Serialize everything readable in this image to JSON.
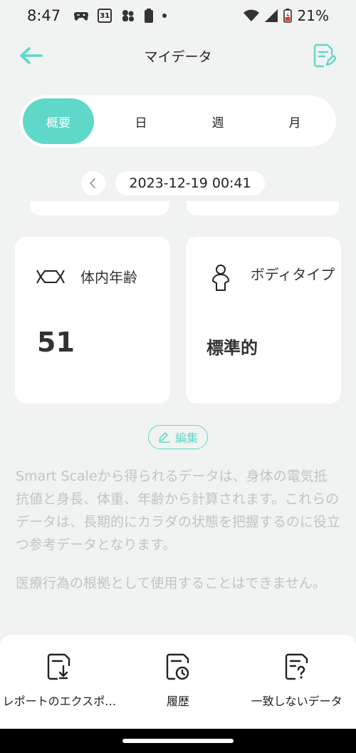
{
  "status_bar": {
    "time": "8:47",
    "calendar_day": "31",
    "battery_percent": "21%"
  },
  "app_bar": {
    "title": "マイデータ"
  },
  "tabs": [
    {
      "label": "概要",
      "active": true
    },
    {
      "label": "日",
      "active": false
    },
    {
      "label": "週",
      "active": false
    },
    {
      "label": "月",
      "active": false
    }
  ],
  "date_nav": {
    "current": "2023-12-19 00:41"
  },
  "metrics": {
    "body_age": {
      "label": "体内年齢",
      "value": "51",
      "icon": "hexagon-molecule-icon"
    },
    "body_type": {
      "label": "ボディタイプ",
      "value": "標準的",
      "icon": "person-icon"
    }
  },
  "edit_label": "編集",
  "notes": {
    "p1": "Smart Scaleから得られるデータは、身体の電気抵抗値と身長、体重、年齢から計算されます。これらのデータは、長期的にカラダの状態を把握するのに役立つ参考データとなります。",
    "p2": "医療行為の根拠として使用することはできません。"
  },
  "bottom_actions": [
    {
      "label": "レポートのエクスポ…",
      "icon": "export-report-icon"
    },
    {
      "label": "履歴",
      "icon": "history-icon"
    },
    {
      "label": "一致しないデータ",
      "icon": "unmatched-data-icon"
    }
  ],
  "colors": {
    "accent": "#5fd8c9",
    "background": "#f1f3f2",
    "card": "#ffffff",
    "muted_text": "#c2c4c4"
  }
}
